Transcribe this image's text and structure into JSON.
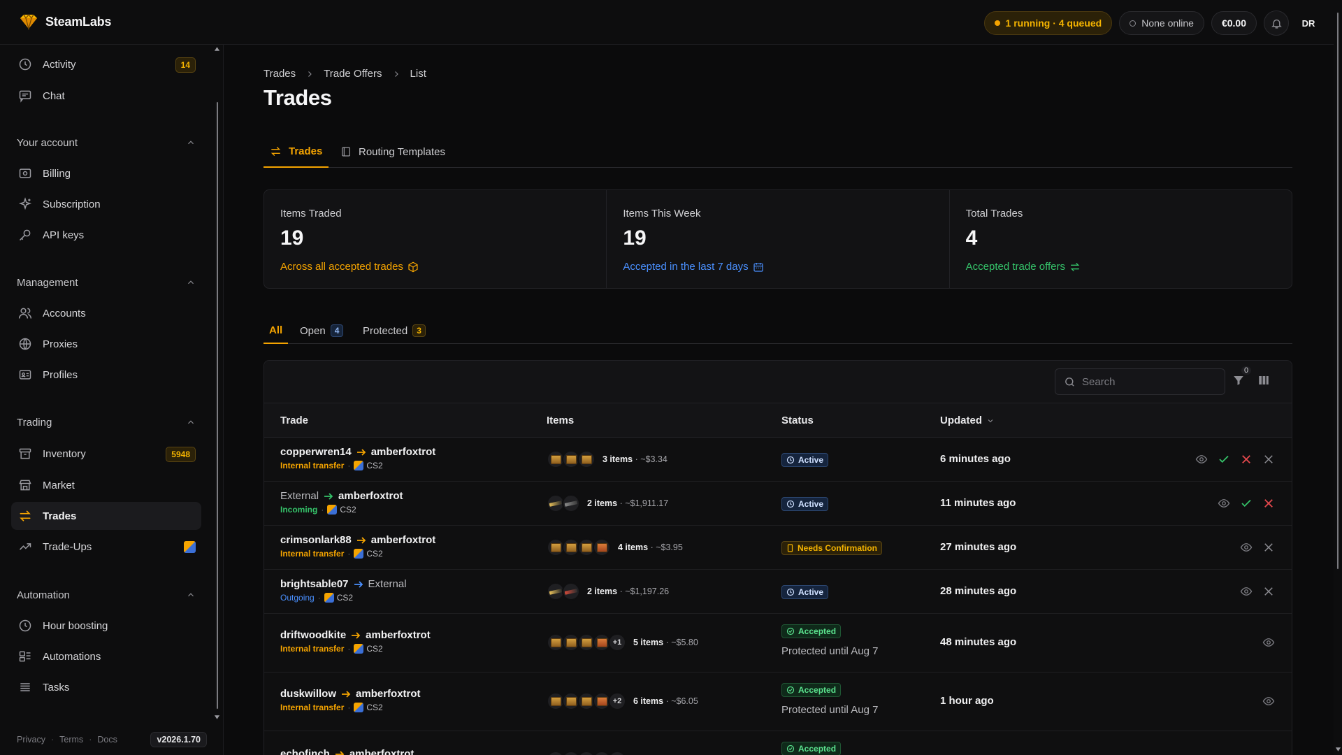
{
  "app": {
    "name": "SteamLabs",
    "running_status": "1 running · 4 queued",
    "online_status": "None online",
    "balance": "€0.00",
    "avatar_initials": "DR",
    "accent_color": "#f5a400"
  },
  "sidebar": {
    "top_items": [
      {
        "label": "Activity",
        "icon": "clock-icon",
        "badge": "14"
      },
      {
        "label": "Chat",
        "icon": "chat-icon"
      }
    ],
    "sections": [
      {
        "title": "Your account",
        "items": [
          {
            "label": "Billing",
            "icon": "billing-icon"
          },
          {
            "label": "Subscription",
            "icon": "sparkles-icon"
          },
          {
            "label": "API keys",
            "icon": "key-icon"
          }
        ]
      },
      {
        "title": "Management",
        "items": [
          {
            "label": "Accounts",
            "icon": "users-icon"
          },
          {
            "label": "Proxies",
            "icon": "globe-icon"
          },
          {
            "label": "Profiles",
            "icon": "id-card-icon"
          }
        ]
      },
      {
        "title": "Trading",
        "items": [
          {
            "label": "Inventory",
            "icon": "archive-icon",
            "badge": "5948"
          },
          {
            "label": "Market",
            "icon": "store-icon"
          },
          {
            "label": "Trades",
            "icon": "swap-icon",
            "active": true
          },
          {
            "label": "Trade-Ups",
            "icon": "trend-icon"
          }
        ]
      },
      {
        "title": "Automation",
        "items": [
          {
            "label": "Hour boosting",
            "icon": "clock-icon"
          },
          {
            "label": "Automations",
            "icon": "automation-icon"
          },
          {
            "label": "Tasks",
            "icon": "list-icon"
          }
        ]
      }
    ],
    "footer": {
      "privacy": "Privacy",
      "terms": "Terms",
      "docs": "Docs",
      "version": "v2026.1.70"
    }
  },
  "breadcrumb": [
    "Trades",
    "Trade Offers",
    "List"
  ],
  "page_title": "Trades",
  "tabs": [
    {
      "label": "Trades",
      "active": true
    },
    {
      "label": "Routing Templates"
    }
  ],
  "stats": [
    {
      "label": "Items Traded",
      "value": "19",
      "sub": "Across all accepted trades",
      "color": "#f5a400",
      "icon": "box-icon"
    },
    {
      "label": "Items This Week",
      "value": "19",
      "sub": "Accepted in the last 7 days",
      "color": "#4a90ff",
      "icon": "calendar-icon"
    },
    {
      "label": "Total Trades",
      "value": "4",
      "sub": "Accepted trade offers",
      "color": "#35c46a",
      "icon": "swap-icon"
    }
  ],
  "subtabs": [
    {
      "label": "All",
      "active": true
    },
    {
      "label": "Open",
      "count": "4"
    },
    {
      "label": "Protected",
      "count": "3"
    }
  ],
  "table": {
    "search_placeholder": "Search",
    "filter_count": "0",
    "columns": {
      "trade": "Trade",
      "items": "Items",
      "status": "Status",
      "updated": "Updated"
    },
    "rows": [
      {
        "from": "copperwren14",
        "to": "amberfoxtrot",
        "type": "Internal transfer",
        "game": "CS2",
        "items_count": "3 items",
        "value": "· ~$3.34",
        "status": "Active",
        "updated": "6 minutes ago"
      },
      {
        "from": "External",
        "to": "amberfoxtrot",
        "type": "Incoming",
        "game": "CS2",
        "items_count": "2 items",
        "value": "· ~$1,911.17",
        "status": "Active",
        "updated": "11 minutes ago"
      },
      {
        "from": "crimsonlark88",
        "to": "amberfoxtrot",
        "type": "Internal transfer",
        "game": "CS2",
        "items_count": "4 items",
        "value": "· ~$3.95",
        "status": "Needs Confirmation",
        "updated": "27 minutes ago"
      },
      {
        "from": "brightsable07",
        "to": "External",
        "type": "Outgoing",
        "game": "CS2",
        "items_count": "2 items",
        "value": "· ~$1,197.26",
        "status": "Active",
        "updated": "28 minutes ago"
      },
      {
        "from": "driftwoodkite",
        "to": "amberfoxtrot",
        "type": "Internal transfer",
        "game": "CS2",
        "items_count": "5 items",
        "value": "· ~$5.80",
        "status": "Accepted",
        "protected": "Protected until Aug 7",
        "more": "+1",
        "updated": "48 minutes ago"
      },
      {
        "from": "duskwillow",
        "to": "amberfoxtrot",
        "type": "Internal transfer",
        "game": "CS2",
        "items_count": "6 items",
        "value": "· ~$6.05",
        "status": "Accepted",
        "protected": "Protected until Aug 7",
        "more": "+2",
        "updated": "1 hour ago"
      },
      {
        "from": "echofinch",
        "to": "amberfoxtrot",
        "status": "Accepted"
      }
    ]
  }
}
